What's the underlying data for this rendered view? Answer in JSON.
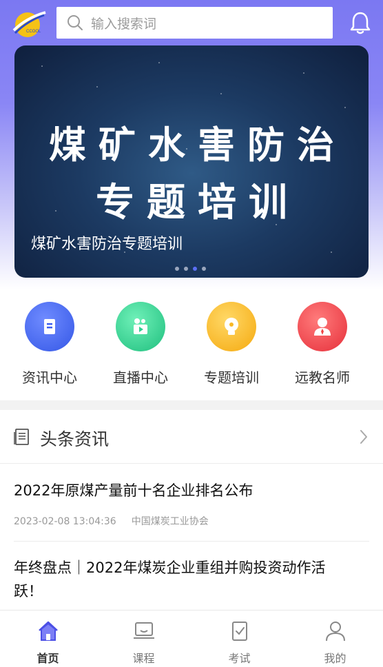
{
  "header": {
    "logo_text": "CCOOL",
    "search_placeholder": "输入搜索词"
  },
  "banner": {
    "title_line1": "煤矿水害防治",
    "title_line2": "专题培训",
    "caption": "煤矿水害防治专题培训",
    "slide_count": 4,
    "active_slide": 3
  },
  "quick_links": [
    {
      "label": "资讯中心",
      "icon": "document-icon",
      "color": "#4a6cf0"
    },
    {
      "label": "直播中心",
      "icon": "video-camera-icon",
      "color": "#2fcf8f"
    },
    {
      "label": "专题培训",
      "icon": "lightbulb-icon",
      "color": "#f9b825"
    },
    {
      "label": "远教名师",
      "icon": "teacher-icon",
      "color": "#f04444"
    }
  ],
  "news_section": {
    "title": "头条资讯",
    "articles": [
      {
        "title": "2022年原煤产量前十名企业排名公布",
        "date": "2023-02-08 13:04:36",
        "source": "中国煤炭工业协会"
      },
      {
        "title": "年终盘点｜2022年煤炭企业重组并购投资动作活跃！"
      }
    ]
  },
  "tabbar": {
    "tabs": [
      {
        "label": "首页",
        "icon": "home-icon",
        "active": true
      },
      {
        "label": "课程",
        "icon": "course-icon",
        "active": false
      },
      {
        "label": "考试",
        "icon": "exam-icon",
        "active": false
      },
      {
        "label": "我的",
        "icon": "profile-icon",
        "active": false
      }
    ],
    "accent": "#4b4fe6"
  }
}
